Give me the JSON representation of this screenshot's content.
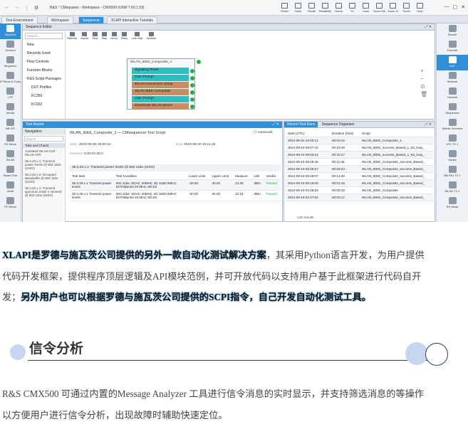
{
  "window": {
    "title": "R&S ⁰ CMsquares - Workspace - CMX500 (USW 7.60.1.53)",
    "toolbar": [
      "Reset",
      "Save",
      "Recall",
      "Reliability",
      "Home",
      "TC",
      "Conn",
      "Zoom Out",
      "Zoom In",
      "Touch",
      "Help"
    ]
  },
  "tabs": [
    "Test Environment",
    "Workspace",
    "Sequencer",
    "XLAPI Interactive Tutorials"
  ],
  "left_nav": [
    "Network",
    "General",
    "Sequence",
    "IP Meas & Tools",
    "LTE",
    "Media",
    "NB IOT",
    "RX Meas",
    "WLAN",
    "Board Test",
    "Multi",
    "PC Meas"
  ],
  "right_nav": [
    "Search",
    "Favorite",
    "DUT",
    "Network",
    "General",
    "Sequencer",
    "Mobile Services",
    "LTE TX 1",
    "Media",
    "NB FB1 TX 1",
    "WLAN TX 1",
    "RX Meas"
  ],
  "sequence_editor": {
    "title": "Sequence Editor",
    "search_placeholder": "Search...",
    "tools": [
      "Refresh",
      "Import",
      "Stop",
      "Skip",
      "Undo",
      "Redo",
      "Line Sep",
      "Options"
    ],
    "tree": [
      "New",
      "Recently Used",
      "Flow Controls",
      "Function Blocks",
      "R&S Script Packages",
      "DUT Profiles",
      "KC350",
      "KC652"
    ],
    "flow_title": "WLAN_IEEE_Composite_1",
    "flow_items": [
      {
        "label": "Signaling Reset",
        "color": "#2bbfc0"
      },
      {
        "label": "User Prompt",
        "color": "#2bbfc0"
      },
      {
        "label": "WLAN Connection Setup",
        "color": "#c98d63"
      },
      {
        "label": "WLAN IEEE Composite",
        "color": "#c98d63"
      },
      {
        "label": "User Prompt",
        "color": "#2bbfc0"
      },
      {
        "label": "Deactivate WLAN device",
        "color": "#c98d63"
      }
    ]
  },
  "test_report": {
    "title": "Test Report",
    "navigation_label": "Navigation",
    "nav_search": "Search",
    "nav_section": "Tabs and Charts",
    "nav_items": [
      "Activated WLAN Cell - WLAN AP0",
      "36.3.20.x.1: Transmit power levels @ 802.11be (SISO)",
      "36.3.20.x.2: Occupied Bandwidth @ 802.11be (SISO)",
      "36.3.20.x.1: Transmit spectrum mask e General @ 802.11be (SISO)"
    ],
    "header_title": "WLAN_IEEE_Composite_1 — CMsequencer Test Script",
    "autoscroll": "Autoscroll",
    "start_label": "Start",
    "start_value": "2024-09-20 19:00:12",
    "end_label": "End",
    "end_value": "2024-09-20 19:11:16",
    "duration_label": "Duration",
    "duration_value": "0.00:02:25.0",
    "section": "36.3.20.x.1: Transmit power levels @ 802.11be (SISO)",
    "columns": [
      "Test Item",
      "Test Condition",
      "Lower Limit",
      "Upper Limit",
      "Measure",
      "Unit",
      "Verdict"
    ],
    "rows": [
      {
        "item": "36.3.20.x.1 Transmit power levels",
        "cond": "802.11be; 5GHz; 20MHz; 36; 5180.0MHz; EHT5Bursts 20 MHz; MCS0",
        "lower": "-30.00",
        "upper": "30.00",
        "meas": "13.25",
        "unit": "dBm",
        "verdict": "Passed"
      },
      {
        "item": "36.3.20.x.1 Transmit power levels",
        "cond": "802.11be; 5GHz; 20MHz; 40; 5200.0MHz; EHT5Bursts 20 MHz; MCS0",
        "lower": "-30.00",
        "upper": "30.00",
        "meas": "13.18",
        "unit": "dBm",
        "verdict": "Passed"
      }
    ]
  },
  "recent_runs": {
    "tab1": "Recent Test Runs",
    "tab2": "Sequence Organizer",
    "columns": [
      "Start (UTC)",
      "Duration (hms)",
      "Script"
    ],
    "rows": [
      [
        "2024-09-20 19:00:12",
        "00:02:15",
        "WLAN_IEEE_Composite_1"
      ],
      [
        "2024-09-19 09:07:42",
        "00:19:49",
        "WLAN_IEEE_success_Based_1_53_loop_"
      ],
      [
        "2024-09-19 09:03:24",
        "00:20:17",
        "WLAN_IEEE_success_Based_1_53_loop_"
      ],
      [
        "2024-09-19 08:49:48",
        "00:11:45",
        "WLAN_IEEE_Composite_success_Based_"
      ],
      [
        "2024-09-19 08:45:57",
        "00:03:23",
        "WLAN_IEEE_Composite_success_Based_"
      ],
      [
        "2024-09-19 08:19:07",
        "00:13:40",
        "WLAN_IEEE_Composite_success_Based_"
      ],
      [
        "2024-09-19 08:16:09",
        "00:01:15",
        "WLAN_IEEE_Composite_success_Based_"
      ],
      [
        "2024-09-19 02:48:52",
        "00:00:18",
        "WLAN_IEEE_Composite"
      ],
      [
        "2024-09-19 02:47:52",
        "00:00:17",
        "WLAN_IEEE_Composite_success_Based_"
      ]
    ],
    "footer": "149 results"
  },
  "article": {
    "p1_line1_highlight": "XLAPI是罗德与施瓦茨公司提供的另外一款自动化测试解决方案",
    "p1_line1_rest": "，其采用Python语言开发，为用户提供",
    "p1_line2": "代码开发框架，提供程序顶层逻辑及API模块范例，并可开放代码以支持用户基于此框架进行代码自开",
    "p1_line3_start": "发；",
    "p1_line3_highlight": "另外用户也可以根据罗德与施瓦茨公司提供的SCPI指令，自己开发自动化测试工具。",
    "heading": "信令分析",
    "p2_line1": "R&S CMX500 可通过内置的Message Analyzer 工具进行信令消息的实时显示，并支持筛选消息的等操作",
    "p2_line2": "以方便用户进行信令分析，出现故障时辅助快速定位。"
  }
}
